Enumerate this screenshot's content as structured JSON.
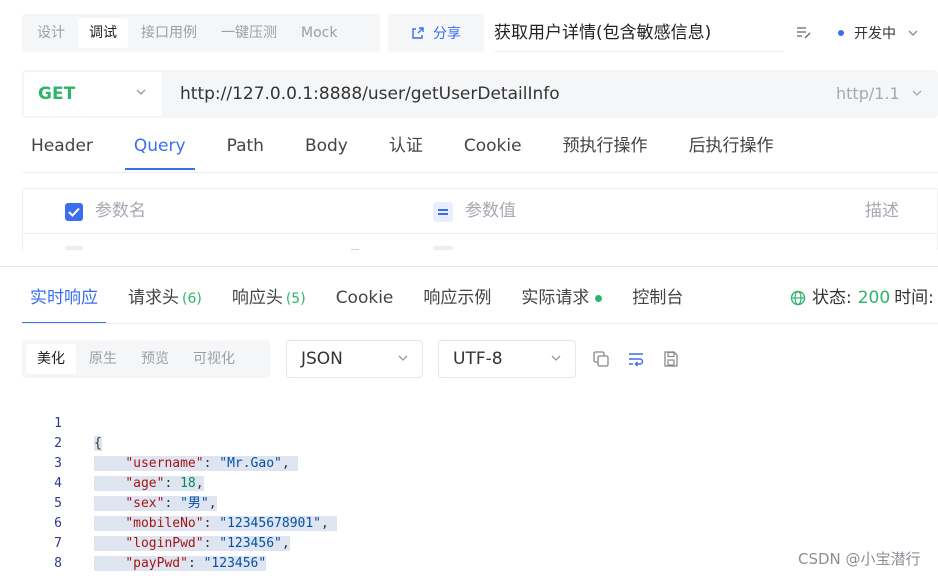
{
  "mode_tabs": [
    "设计",
    "调试",
    "接口用例",
    "一键压测",
    "Mock"
  ],
  "active_mode": "调试",
  "share_label": "分享",
  "api_title": "获取用户详情(包含敏感信息)",
  "status": "开发中",
  "method": "GET",
  "url": "http://127.0.0.1:8888/user/getUserDetailInfo",
  "protocol": "http/1.1",
  "request_tabs": [
    "Header",
    "Query",
    "Path",
    "Body",
    "认证",
    "Cookie",
    "预执行操作",
    "后执行操作"
  ],
  "active_request_tab": "Query",
  "param_table": {
    "name_header": "参数名",
    "value_header": "参数值",
    "desc_header": "描述"
  },
  "response_tabs": {
    "realtime": "实时响应",
    "req_headers": "请求头",
    "req_headers_count": "(6)",
    "resp_headers": "响应头",
    "resp_headers_count": "(5)",
    "cookie": "Cookie",
    "example": "响应示例",
    "actual": "实际请求",
    "console": "控制台"
  },
  "response_status": {
    "label": "状态:",
    "code": "200",
    "time_label": "时间:"
  },
  "view_tabs": [
    "美化",
    "原生",
    "预览",
    "可视化"
  ],
  "active_view": "美化",
  "format": "JSON",
  "encoding": "UTF-8",
  "code": {
    "line_numbers": [
      "1",
      "2",
      "3",
      "4",
      "5",
      "6",
      "7",
      "8"
    ],
    "open": "{",
    "close": "}",
    "fields": [
      {
        "key": "\"username\"",
        "value": "\"Mr.Gao\"",
        "type": "string",
        "comma": ","
      },
      {
        "key": "\"age\"",
        "value": "18",
        "type": "number",
        "comma": ","
      },
      {
        "key": "\"sex\"",
        "value": "\"男\"",
        "type": "string",
        "comma": ","
      },
      {
        "key": "\"mobileNo\"",
        "value": "\"12345678901\"",
        "type": "string",
        "comma": ","
      },
      {
        "key": "\"loginPwd\"",
        "value": "\"123456\"",
        "type": "string",
        "comma": ","
      },
      {
        "key": "\"payPwd\"",
        "value": "\"123456\"",
        "type": "string",
        "comma": ""
      }
    ]
  },
  "watermark": "CSDN @小宝潜行",
  "colors": {
    "accent": "#3a6df0",
    "success": "#2fb56b"
  }
}
